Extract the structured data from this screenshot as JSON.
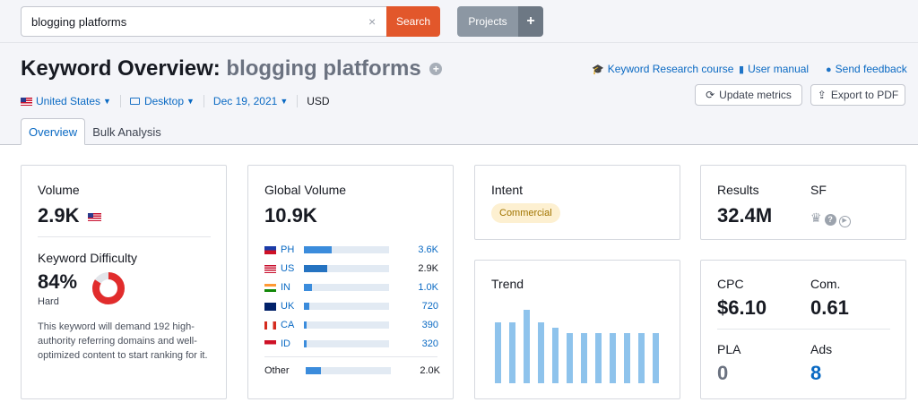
{
  "search": {
    "value": "blogging platforms",
    "button": "Search",
    "clear": "×"
  },
  "projects": {
    "label": "Projects",
    "plus": "+"
  },
  "title": {
    "prefix": "Keyword Overview:",
    "keyword": "blogging platforms",
    "add": "+"
  },
  "links": [
    {
      "label": "Keyword Research course",
      "icon": "graduation-cap-icon"
    },
    {
      "label": "User manual",
      "icon": "book-icon"
    },
    {
      "label": "Send feedback",
      "icon": "chat-bubble-icon"
    }
  ],
  "filters": {
    "country": "United States",
    "device": "Desktop",
    "date": "Dec 19, 2021",
    "currency": "USD"
  },
  "buttons": {
    "update": "Update metrics",
    "export": "Export to PDF"
  },
  "tabs": [
    "Overview",
    "Bulk Analysis"
  ],
  "volume": {
    "title": "Volume",
    "value": "2.9K"
  },
  "kd": {
    "title": "Keyword Difficulty",
    "value": "84%",
    "level": "Hard",
    "percent": 84,
    "color": "#e12c2c",
    "description": "This keyword will demand 192 high-authority referring domains and well-optimized content to start ranking for it."
  },
  "global_volume": {
    "title": "Global Volume",
    "value": "10.9K",
    "rows": [
      {
        "code": "PH",
        "value": "3.6K",
        "share": 0.33
      },
      {
        "code": "US",
        "value": "2.9K",
        "share": 0.27
      },
      {
        "code": "IN",
        "value": "1.0K",
        "share": 0.09
      },
      {
        "code": "UK",
        "value": "720",
        "share": 0.066
      },
      {
        "code": "CA",
        "value": "390",
        "share": 0.036
      },
      {
        "code": "ID",
        "value": "320",
        "share": 0.03
      }
    ],
    "other": {
      "code": "Other",
      "value": "2.0K",
      "share": 0.18
    }
  },
  "intent": {
    "title": "Intent",
    "badge": "Commercial"
  },
  "trend": {
    "title": "Trend",
    "values": [
      0.71,
      0.71,
      0.85,
      0.71,
      0.65,
      0.58,
      0.58,
      0.58,
      0.58,
      0.58,
      0.58,
      0.58
    ]
  },
  "results": {
    "title": "Results",
    "value": "32.4M",
    "sf_title": "SF",
    "sf_icons": [
      "crown-icon",
      "question-circle-icon",
      "play-circle-icon"
    ]
  },
  "cpc": {
    "title": "CPC",
    "value": "$6.10"
  },
  "com": {
    "title": "Com.",
    "value": "0.61"
  },
  "pla": {
    "title": "PLA",
    "value": "0"
  },
  "ads": {
    "title": "Ads",
    "value": "8"
  },
  "colors": {
    "accent": "#0969c3",
    "search_button": "#e2572b",
    "bar": "#3b8cdc",
    "trend_bar": "#8ec3ec",
    "intent_bg": "#fdf0d1"
  }
}
